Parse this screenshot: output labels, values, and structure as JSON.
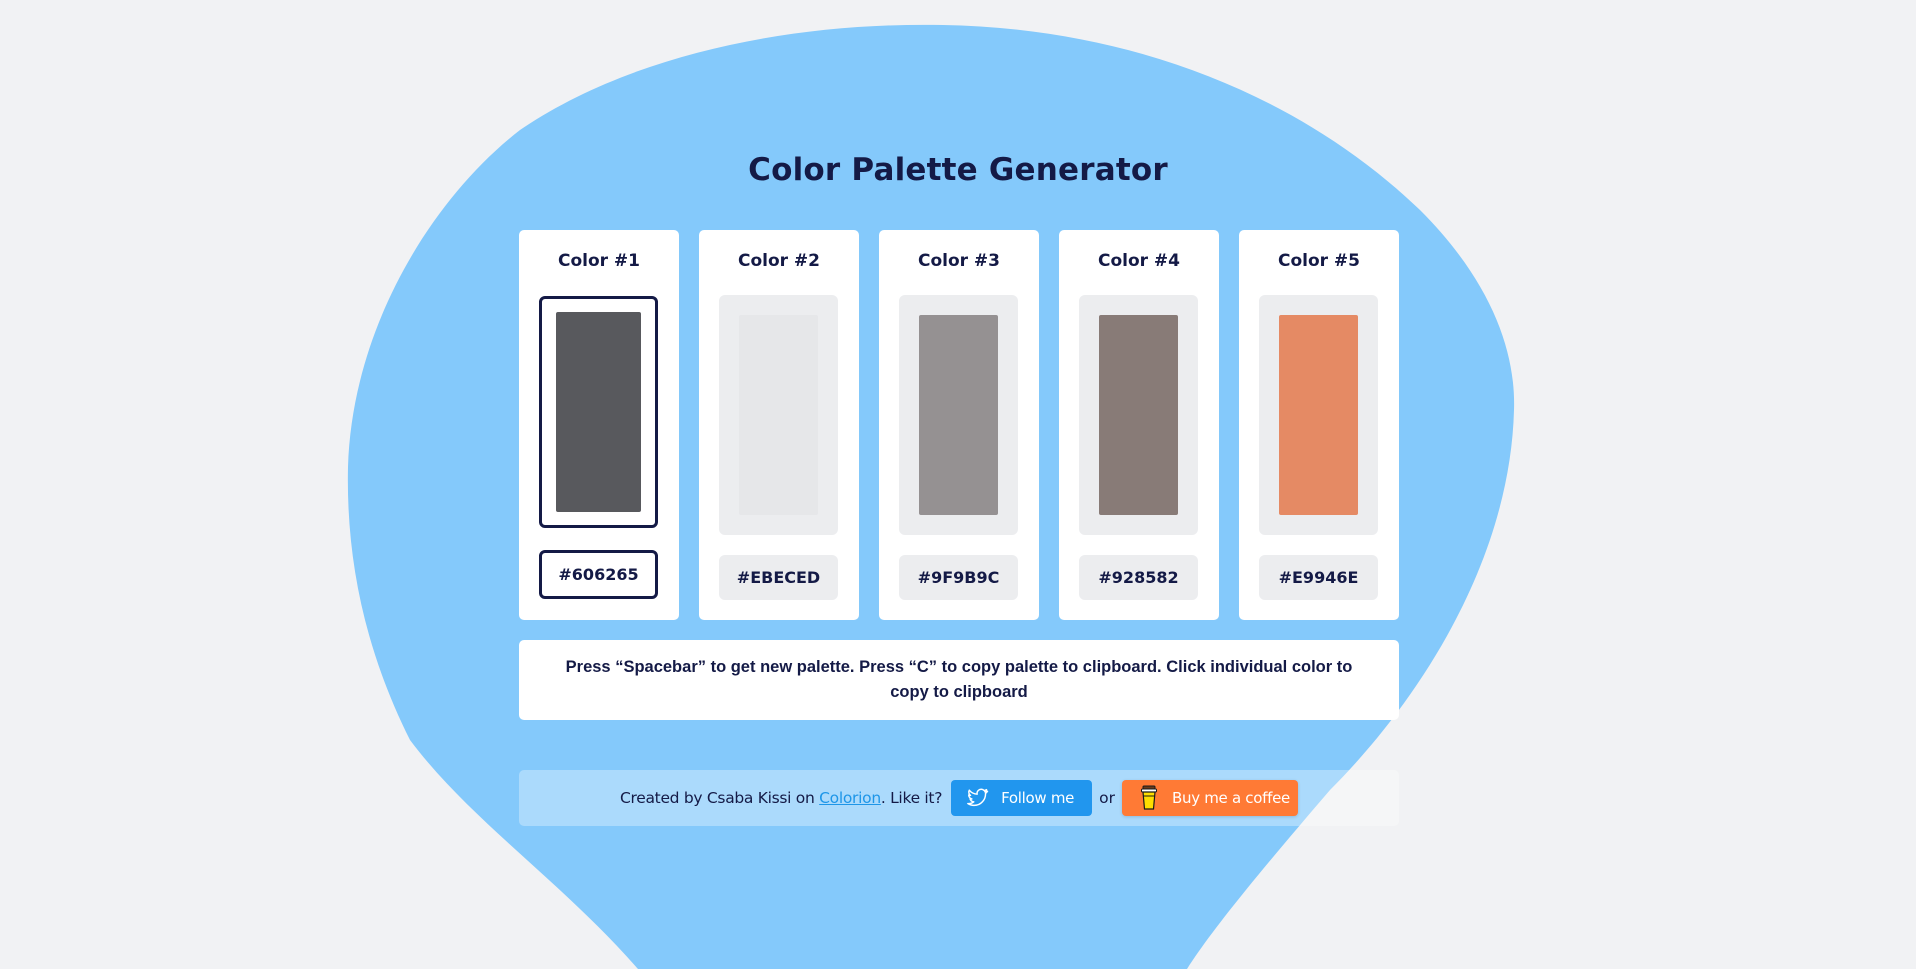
{
  "app": {
    "title": "Color Palette Generator"
  },
  "theme": {
    "background": "#f1f2f4",
    "blob_color": "#84c9fb",
    "text_color": "#141a46",
    "panel_bg": "#ecedef"
  },
  "palette": {
    "selected_index": 0,
    "colors": [
      {
        "label": "Color #1",
        "hex": "#606265",
        "swatch": "#58595d",
        "selected": true
      },
      {
        "label": "Color #2",
        "hex": "#EBECED",
        "swatch": "#e6e7e9",
        "selected": false
      },
      {
        "label": "Color #3",
        "hex": "#9F9B9C",
        "swatch": "#959192",
        "selected": false
      },
      {
        "label": "Color #4",
        "hex": "#928582",
        "swatch": "#887b77",
        "selected": false
      },
      {
        "label": "Color #5",
        "hex": "#E9946E",
        "swatch": "#e58a64",
        "selected": false
      }
    ]
  },
  "instructions": {
    "text": "Press “Spacebar” to get new palette. Press “C” to copy palette to clipboard. Click individual color to copy to clipboard"
  },
  "footer": {
    "credit_prefix": "Created by Csaba Kissi on ",
    "link_label": "Colorion",
    "credit_suffix": ". Like it?",
    "follow_label": "Follow me",
    "follow_icon": "twitter-bird-icon",
    "follow_color": "#2196ee",
    "or_label": "or",
    "coffee_label": "Buy me a coffee",
    "coffee_icon": "coffee-cup-icon",
    "coffee_color": "#ff7a35"
  }
}
